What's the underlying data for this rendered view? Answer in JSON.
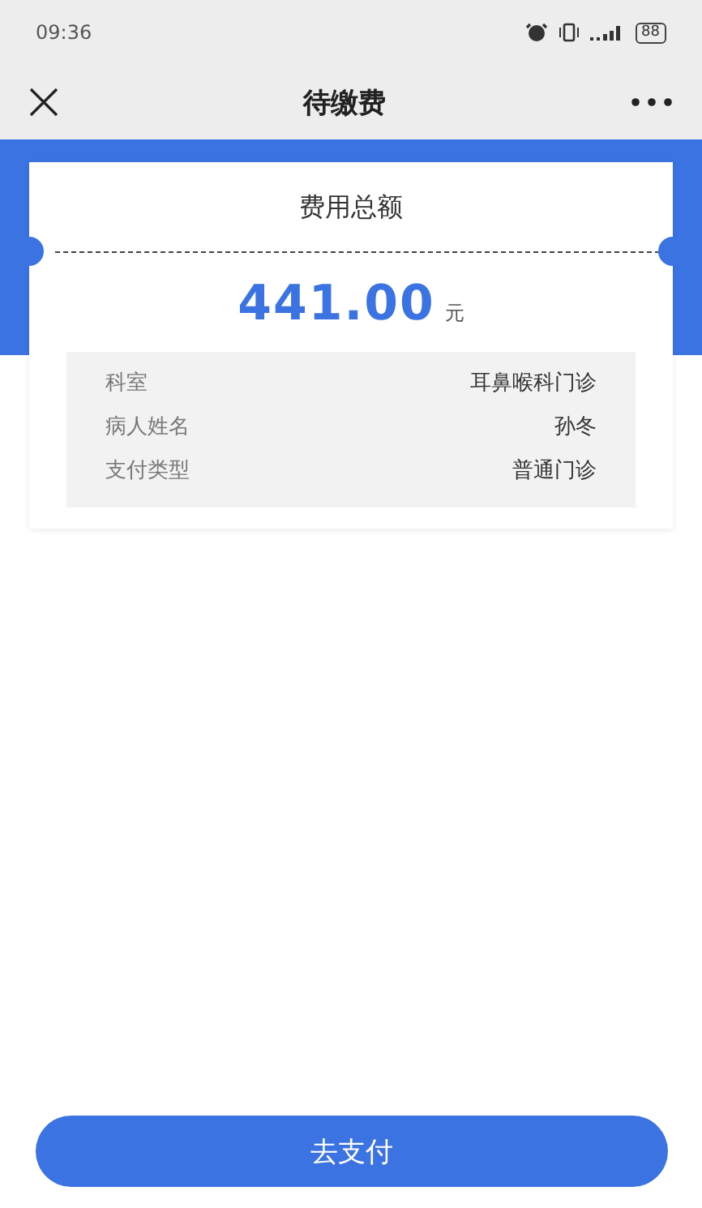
{
  "status_bar": {
    "time": "09:36",
    "battery": "88"
  },
  "nav": {
    "title": "待缴费"
  },
  "summary": {
    "label": "费用总额",
    "amount": "441.00",
    "unit": "元"
  },
  "details": [
    {
      "label": "科室",
      "value": "耳鼻喉科门诊"
    },
    {
      "label": "病人姓名",
      "value": "孙冬"
    },
    {
      "label": "支付类型",
      "value": "普通门诊"
    }
  ],
  "pay_button": "去支付"
}
